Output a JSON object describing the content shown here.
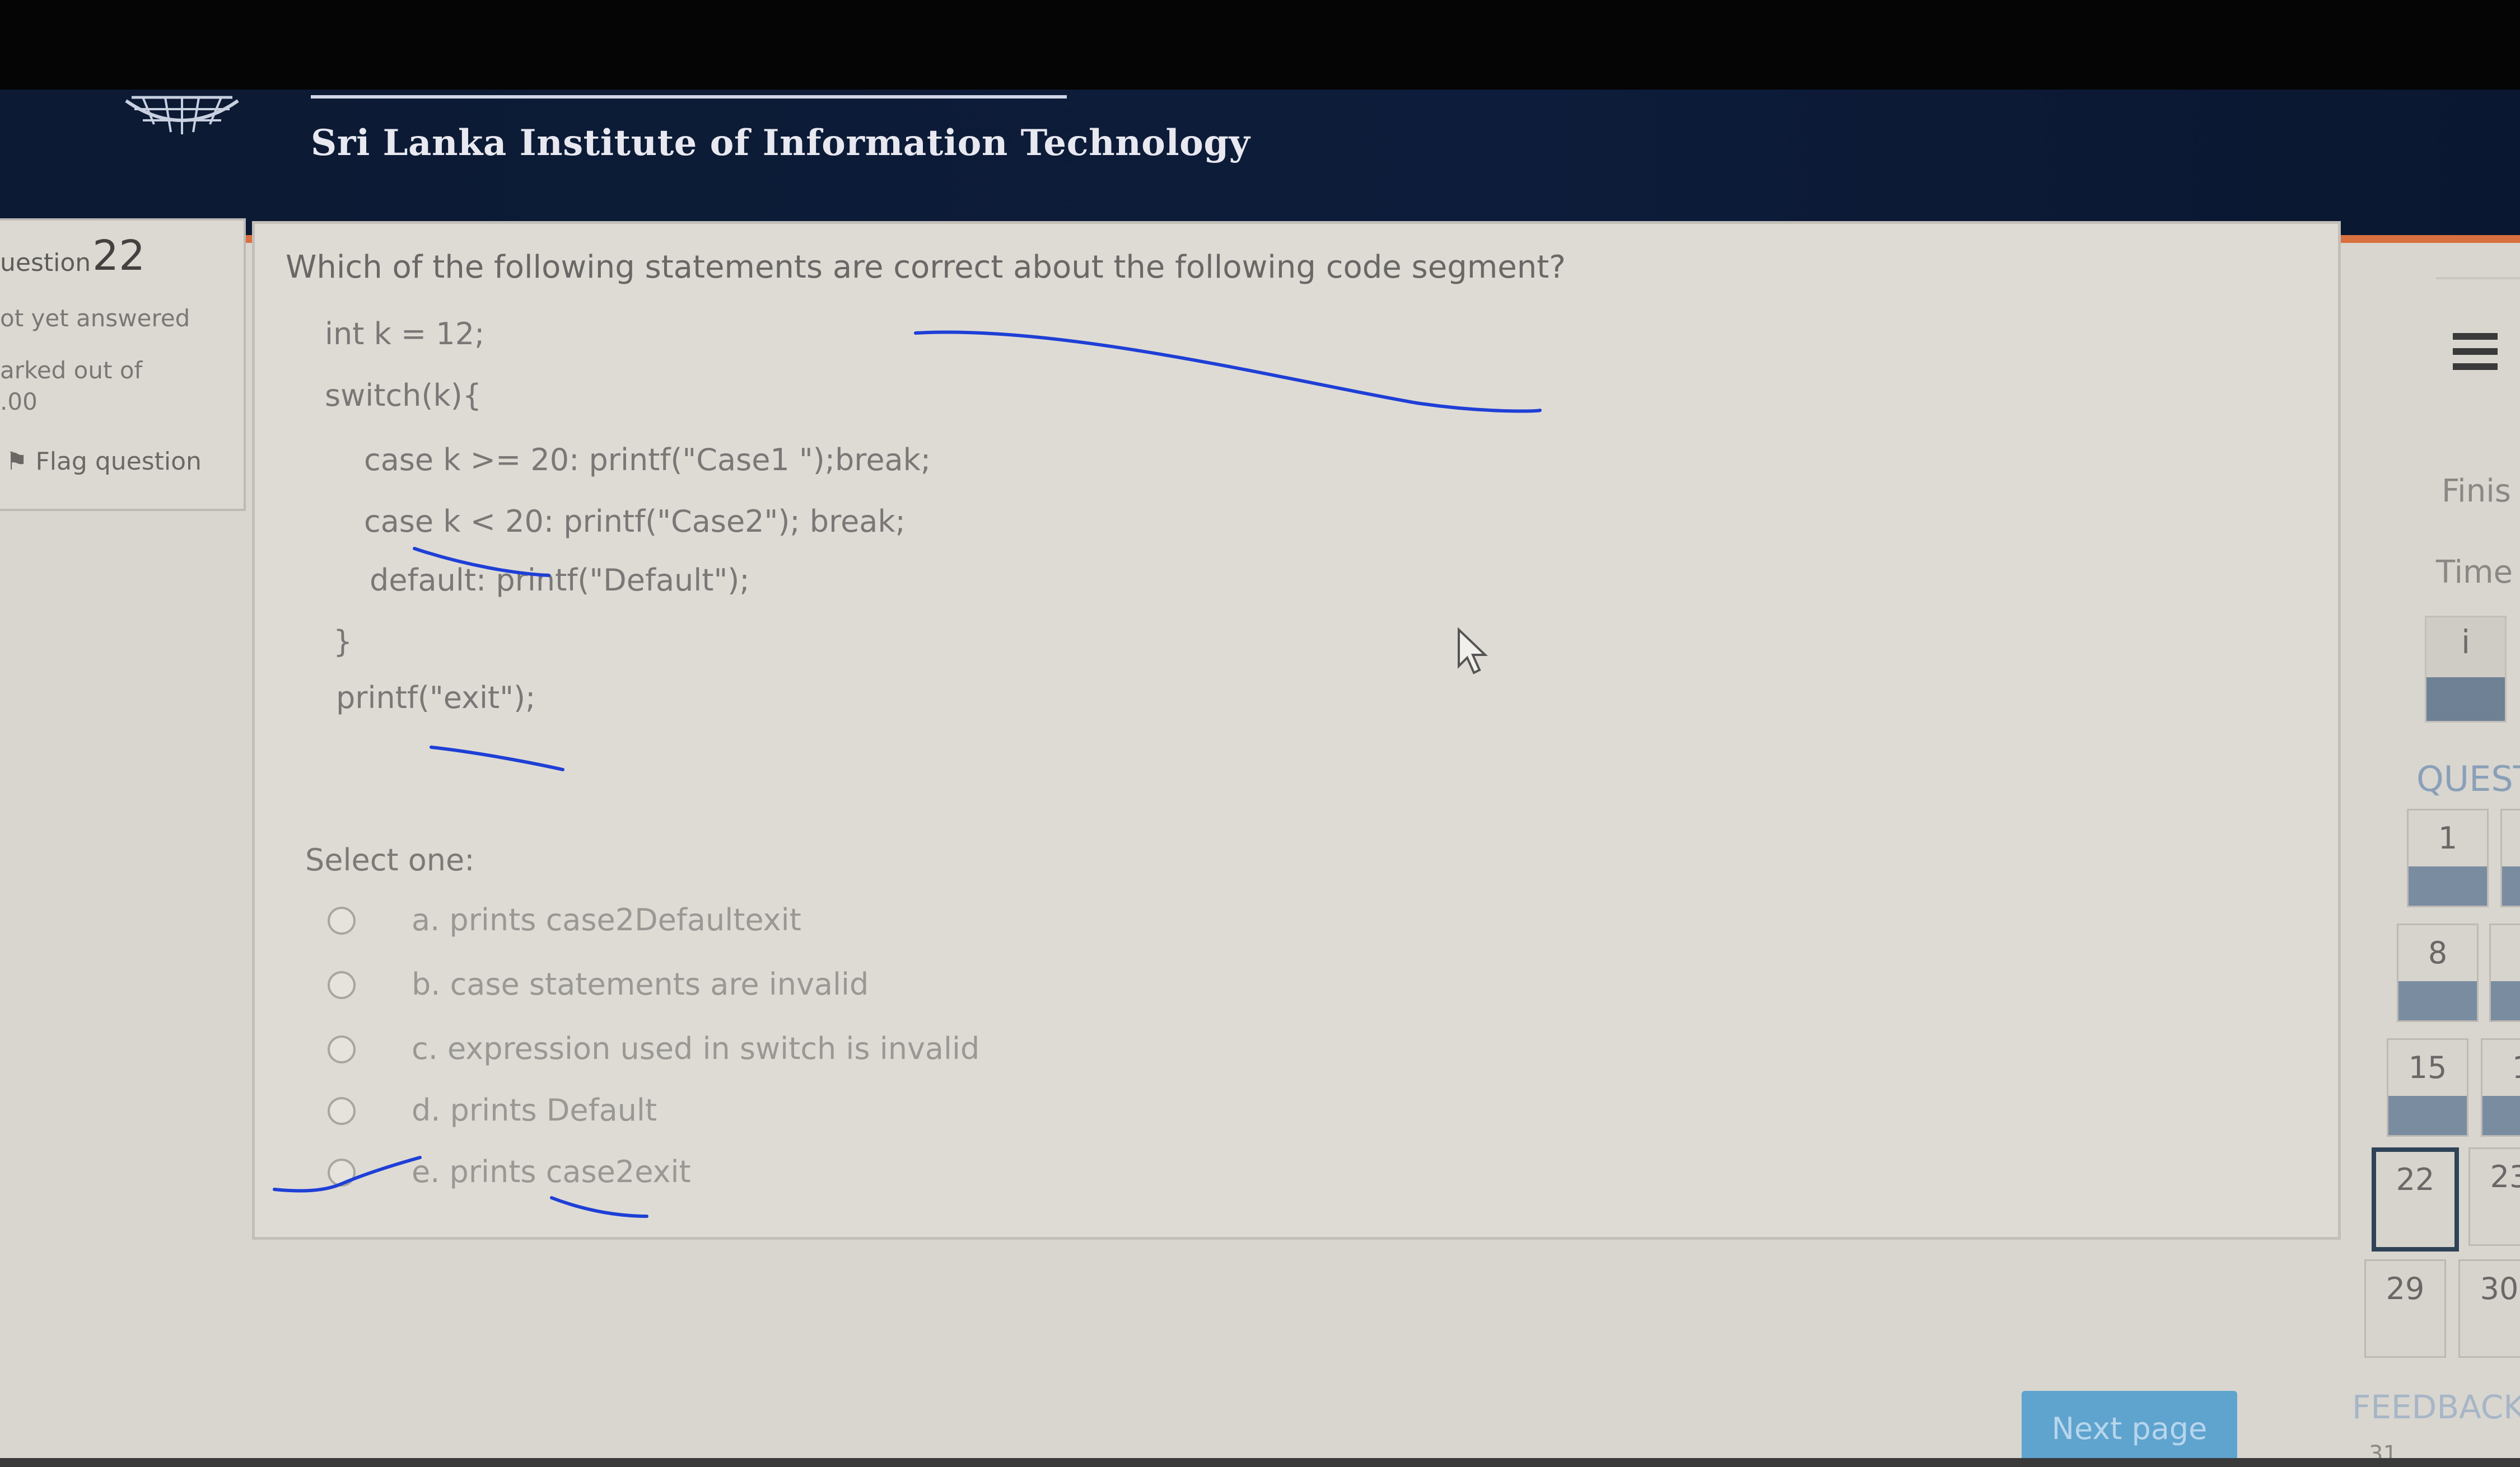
{
  "header": {
    "institute_name": "Sri Lanka Institute of Information Technology",
    "logo_icon": "institute-logo-icon"
  },
  "question_info": {
    "label": "uestion",
    "number": "22",
    "status": "ot yet answered",
    "marked_line1": "arked out of",
    "marked_line2": ".00",
    "flag_label": "Flag question"
  },
  "question": {
    "text": "Which of the following statements are correct about the  following code segment?",
    "code": [
      "int k = 12;",
      "switch(k){",
      "case k >= 20: printf(\"Case1 \");break;",
      "case k < 20: printf(\"Case2\"); break;",
      "default: printf(\"Default\");",
      "}",
      "printf(\"exit\");"
    ],
    "select_prompt": "Select one:",
    "options": [
      "a. prints case2Defaultexit",
      "b. case statements are invalid",
      "c. expression used in switch is invalid",
      "d. prints Default",
      "e. prints case2exit"
    ]
  },
  "navigation": {
    "menu_icon": "hamburger-menu-icon",
    "finish_label": "Finis",
    "timer_label": "Time",
    "info_glyph": "i",
    "heading": "QUEST",
    "tiles": [
      "1",
      "8",
      "15",
      "22",
      "29",
      "30"
    ],
    "partial_tiles": [
      "1",
      "23"
    ],
    "feedback_label": "FEEDBACK",
    "feedback_number": "31"
  },
  "footer": {
    "next_label": "Next page"
  },
  "colors": {
    "header_bg": "#0c1a33",
    "header_accent": "#d9703f",
    "next_button": "#5fa3cf",
    "ink": "#1e3fd6"
  }
}
